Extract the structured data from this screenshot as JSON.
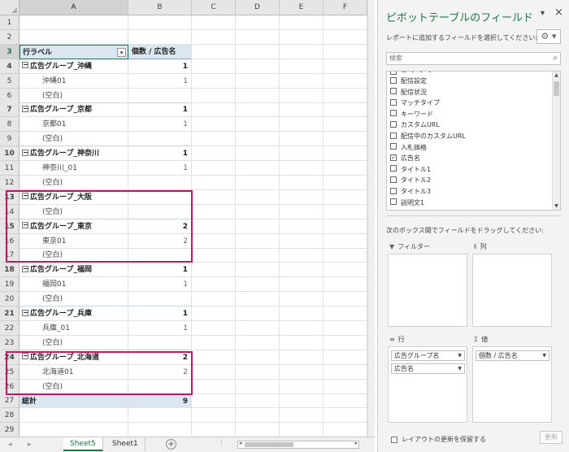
{
  "columns": [
    "A",
    "B",
    "C",
    "D",
    "E",
    "F"
  ],
  "pivot": {
    "header_label": "行ラベル",
    "header_value": "個数 / 広告名",
    "rows": [
      {
        "n": "1",
        "kind": "empty"
      },
      {
        "n": "2",
        "kind": "empty"
      },
      {
        "n": "3",
        "kind": "header"
      },
      {
        "n": "4",
        "kind": "group",
        "label": "広告グループ_沖縄",
        "value": "1"
      },
      {
        "n": "5",
        "kind": "item",
        "label": "沖縄01",
        "value": "1"
      },
      {
        "n": "6",
        "kind": "item",
        "label": "(空白)",
        "value": ""
      },
      {
        "n": "7",
        "kind": "group",
        "label": "広告グループ_京都",
        "value": "1"
      },
      {
        "n": "8",
        "kind": "item",
        "label": "京都01",
        "value": "1"
      },
      {
        "n": "9",
        "kind": "item",
        "label": "(空白)",
        "value": ""
      },
      {
        "n": "10",
        "kind": "group",
        "label": "広告グループ_神奈川",
        "value": "1"
      },
      {
        "n": "11",
        "kind": "item",
        "label": "神奈川_01",
        "value": "1"
      },
      {
        "n": "12",
        "kind": "item",
        "label": "(空白)",
        "value": ""
      },
      {
        "n": "13",
        "kind": "group",
        "label": "広告グループ_大阪",
        "value": ""
      },
      {
        "n": "14",
        "kind": "item",
        "label": "(空白)",
        "value": ""
      },
      {
        "n": "15",
        "kind": "group",
        "label": "広告グループ_東京",
        "value": "2"
      },
      {
        "n": "16",
        "kind": "item",
        "label": "東京01",
        "value": "2"
      },
      {
        "n": "17",
        "kind": "item",
        "label": "(空白)",
        "value": ""
      },
      {
        "n": "18",
        "kind": "group",
        "label": "広告グループ_福岡",
        "value": "1"
      },
      {
        "n": "19",
        "kind": "item",
        "label": "福岡01",
        "value": "1"
      },
      {
        "n": "20",
        "kind": "item",
        "label": "(空白)",
        "value": ""
      },
      {
        "n": "21",
        "kind": "group",
        "label": "広告グループ_兵庫",
        "value": "1"
      },
      {
        "n": "22",
        "kind": "item",
        "label": "兵庫_01",
        "value": "1"
      },
      {
        "n": "23",
        "kind": "item",
        "label": "(空白)",
        "value": ""
      },
      {
        "n": "24",
        "kind": "group",
        "label": "広告グループ_北海道",
        "value": "2"
      },
      {
        "n": "25",
        "kind": "item",
        "label": "北海道01",
        "value": "2"
      },
      {
        "n": "26",
        "kind": "item",
        "label": "(空白)",
        "value": ""
      },
      {
        "n": "27",
        "kind": "total",
        "label": "総計",
        "value": "9"
      },
      {
        "n": "28",
        "kind": "empty"
      },
      {
        "n": "29",
        "kind": "empty"
      }
    ]
  },
  "highlight_color": "#c0176b",
  "accent_color": "#217346",
  "tabs": {
    "sheet5": "Sheet5",
    "sheet1": "Sheet1",
    "add": "⊕"
  },
  "pane": {
    "title": "ピボットテーブルのフィールド",
    "dropdown": "▾",
    "close": "×",
    "subtitle": "レポートに追加するフィールドを選択してください:",
    "gear": "⚙ ▾",
    "search_placeholder": "検索",
    "fields": [
      {
        "label": "配信設定",
        "checked": false
      },
      {
        "label": "配信状況",
        "checked": false
      },
      {
        "label": "マッチタイプ",
        "checked": false
      },
      {
        "label": "キーワード",
        "checked": false
      },
      {
        "label": "カスタムURL",
        "checked": false
      },
      {
        "label": "配信中のカスタムURL",
        "checked": false
      },
      {
        "label": "入札価格",
        "checked": false
      },
      {
        "label": "広告名",
        "checked": true
      },
      {
        "label": "タイトル1",
        "checked": false
      },
      {
        "label": "タイトル2",
        "checked": false
      },
      {
        "label": "タイトル3",
        "checked": false
      },
      {
        "label": "説明文1",
        "checked": false
      }
    ],
    "drag_hint": "次のボックス間でフィールドをドラッグしてください:",
    "areas": {
      "filter": {
        "label": "フィルター",
        "icon": "▼"
      },
      "columns": {
        "label": "列",
        "icon": "⦀"
      },
      "rows": {
        "label": "行",
        "icon": "≡",
        "items": [
          "広告グループ名",
          "広告名"
        ]
      },
      "values": {
        "label": "値",
        "icon": "Σ",
        "items": [
          "個数 / 広告名"
        ]
      }
    },
    "defer_label": "レイアウトの更新を保留する",
    "update_label": "更新"
  }
}
